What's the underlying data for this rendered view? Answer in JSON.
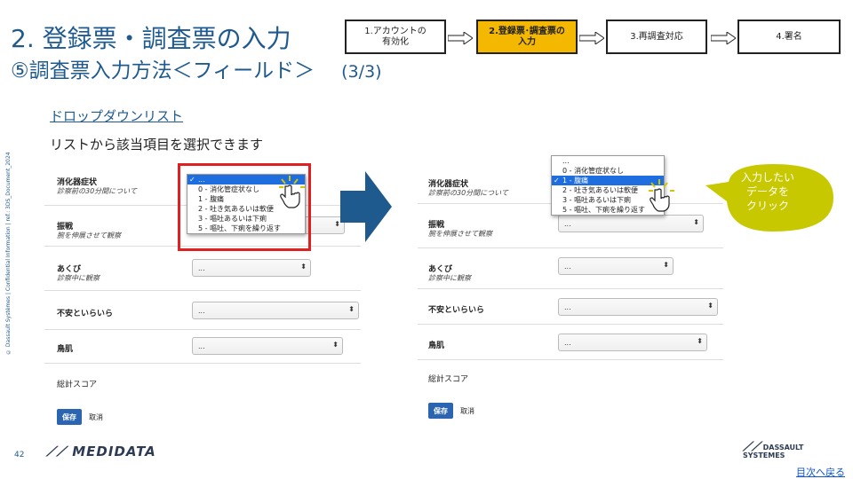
{
  "title": {
    "main": "2. 登録票・調査票の入力",
    "sub": "⑤調査票入力方法＜フィールド＞",
    "page": "(3/3)"
  },
  "steps": [
    {
      "label_line1": "1.アカウントの",
      "label_line2": "有効化"
    },
    {
      "label_line1": "2.登録票･調査票の",
      "label_line2": "入力"
    },
    {
      "label_line1": "3.再調査対応",
      "label_line2": ""
    },
    {
      "label_line1": "4.署名",
      "label_line2": ""
    }
  ],
  "side_note": "© Dassault Systèmes | Confidential Information | ref.: 3DS_Document_2024",
  "dropdown_section": {
    "heading": "ドロップダウンリスト",
    "description": "リストから該当項目を選択できます"
  },
  "form": {
    "rows": [
      {
        "label": "消化器症状",
        "sub": "診察前の30分間について",
        "value": "..."
      },
      {
        "label": "振戦",
        "sub": "腕を伸展させて観察",
        "value": "..."
      },
      {
        "label": "あくび",
        "sub": "診察中に観察",
        "value": "..."
      },
      {
        "label": "不安といらいら",
        "sub": "",
        "value": "..."
      },
      {
        "label": "鳥肌",
        "sub": "",
        "value": "..."
      },
      {
        "label": "総計スコア",
        "sub": "",
        "value": ""
      }
    ],
    "save_label": "保存",
    "cancel_label": "取消"
  },
  "dropdown_options": [
    "...",
    "0 - 消化管症状なし",
    "1 - 腹痛",
    "2 - 吐き気あるいは軟便",
    "3 - 嘔吐あるいは下痢",
    "5 - 嘔吐、下痢を繰り返す"
  ],
  "callout": {
    "line1": "入力したい",
    "line2": "データを",
    "line3": "クリック"
  },
  "footer": {
    "page_number": "42",
    "medidata_logo": "MEDIDATA",
    "ds_logo_line1": "DASSAULT",
    "ds_logo_line2": "SYSTEMES",
    "back_link": "目次へ戻る"
  },
  "colors": {
    "title": "#1f5a8f",
    "active_step": "#f5b800",
    "highlight_box": "#e02020",
    "selected_option": "#1e6ee0",
    "arrow": "#1f5a8f",
    "callout": "#c8c800",
    "save_button": "#2b64b0"
  }
}
